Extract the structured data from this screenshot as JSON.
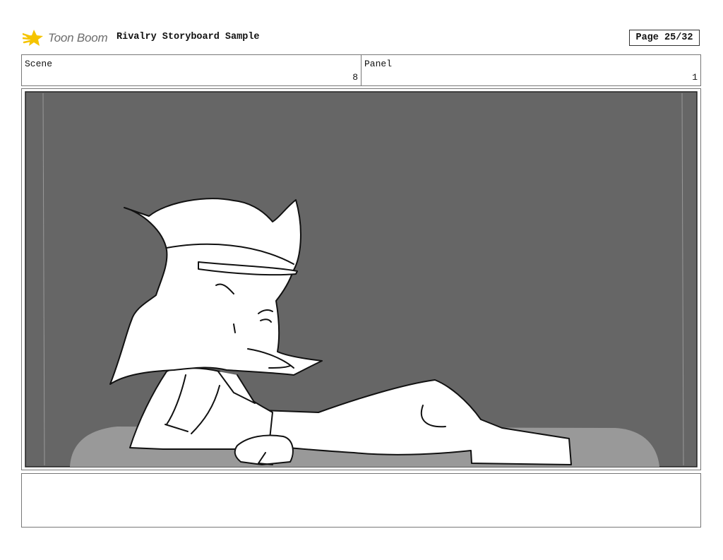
{
  "header": {
    "logo_text": "Toon Boom",
    "title": "Rivalry Storyboard Sample",
    "page_indicator": "Page 25/32"
  },
  "scene": {
    "label": "Scene",
    "value": "8"
  },
  "panel": {
    "label": "Panel",
    "value": "1"
  },
  "notes": {
    "text": ""
  },
  "colors": {
    "background_wall": "#666666",
    "couch": "#999999",
    "line": "#111111",
    "logo_accent": "#f5c400"
  }
}
